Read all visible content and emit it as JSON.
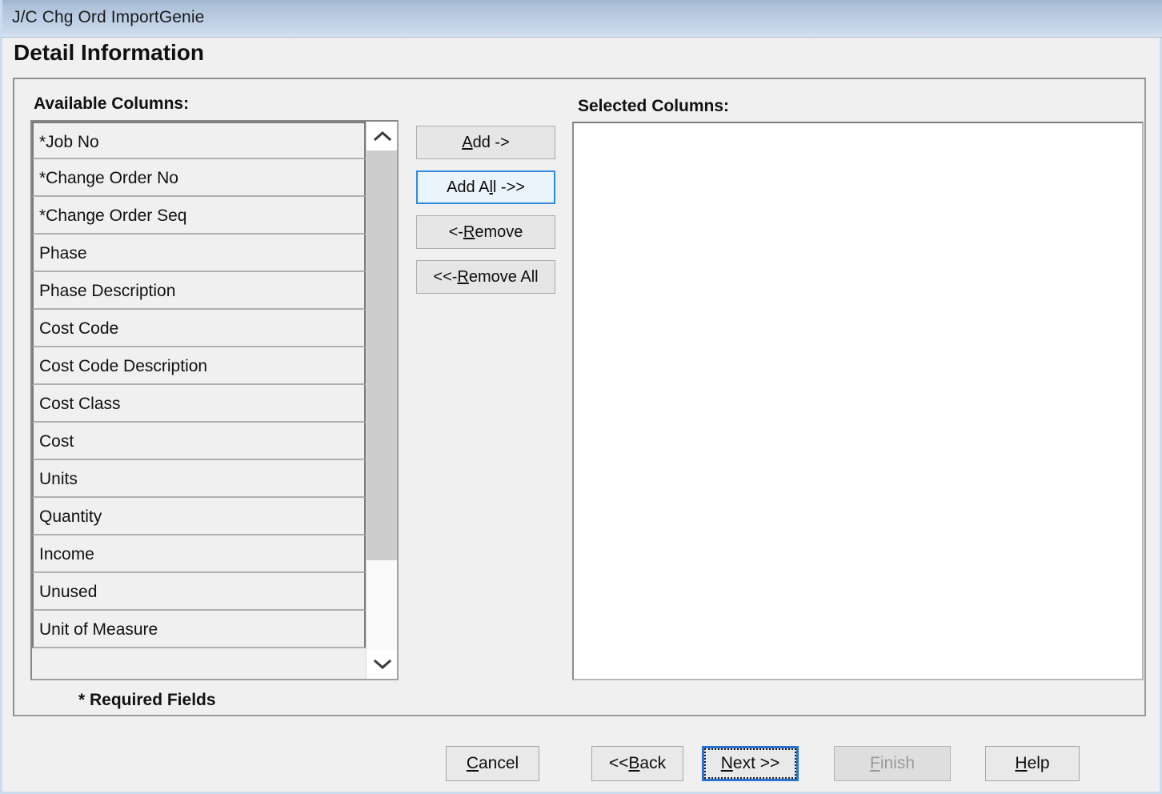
{
  "window": {
    "title": "J/C Chg Ord ImportGenie",
    "page_heading": "Detail Information",
    "title_bar_color": "#bccee4",
    "dialog_bg": "#f0f0f0"
  },
  "available": {
    "label": "Available Columns:",
    "required_note": "* Required Fields",
    "items": [
      "*Job No",
      "*Change Order No",
      "*Change Order Seq",
      "Phase",
      "Phase Description",
      "Cost Code",
      "Cost Code Description",
      "Cost Class",
      "Cost",
      "Units",
      "Quantity",
      "Income",
      "Unused",
      "Unit of Measure"
    ],
    "scrollbar": {
      "up_icon": "chevron-up-icon",
      "down_icon": "chevron-down-icon",
      "thumb_fraction_percent": 82,
      "thumb_color": "#cdcdcd"
    }
  },
  "transfer_buttons": [
    {
      "id": "add",
      "label": "Add ->",
      "mnemonic": "A",
      "highlighted": false
    },
    {
      "id": "add_all",
      "label": "Add All ->>",
      "mnemonic": "l",
      "highlighted": true
    },
    {
      "id": "remove",
      "label": "<- Remove",
      "mnemonic": "R",
      "highlighted": false
    },
    {
      "id": "remove_all",
      "label": "<<- Remove All",
      "mnemonic": "R",
      "highlighted": false
    }
  ],
  "selected": {
    "label": "Selected Columns:",
    "items": [],
    "background": "#ffffff"
  },
  "nav_buttons": {
    "cancel": {
      "label": "Cancel",
      "mnemonic": "C",
      "enabled": true,
      "default": false
    },
    "back": {
      "label": "<< Back",
      "mnemonic": "B",
      "enabled": true,
      "default": false
    },
    "next": {
      "label": "Next >>",
      "mnemonic": "N",
      "enabled": true,
      "default": true,
      "focus_border_color": "#2a73d1"
    },
    "finish": {
      "label": "Finish",
      "mnemonic": "F",
      "enabled": false,
      "default": false
    },
    "help": {
      "label": "Help",
      "mnemonic": "H",
      "enabled": true,
      "default": false
    }
  }
}
